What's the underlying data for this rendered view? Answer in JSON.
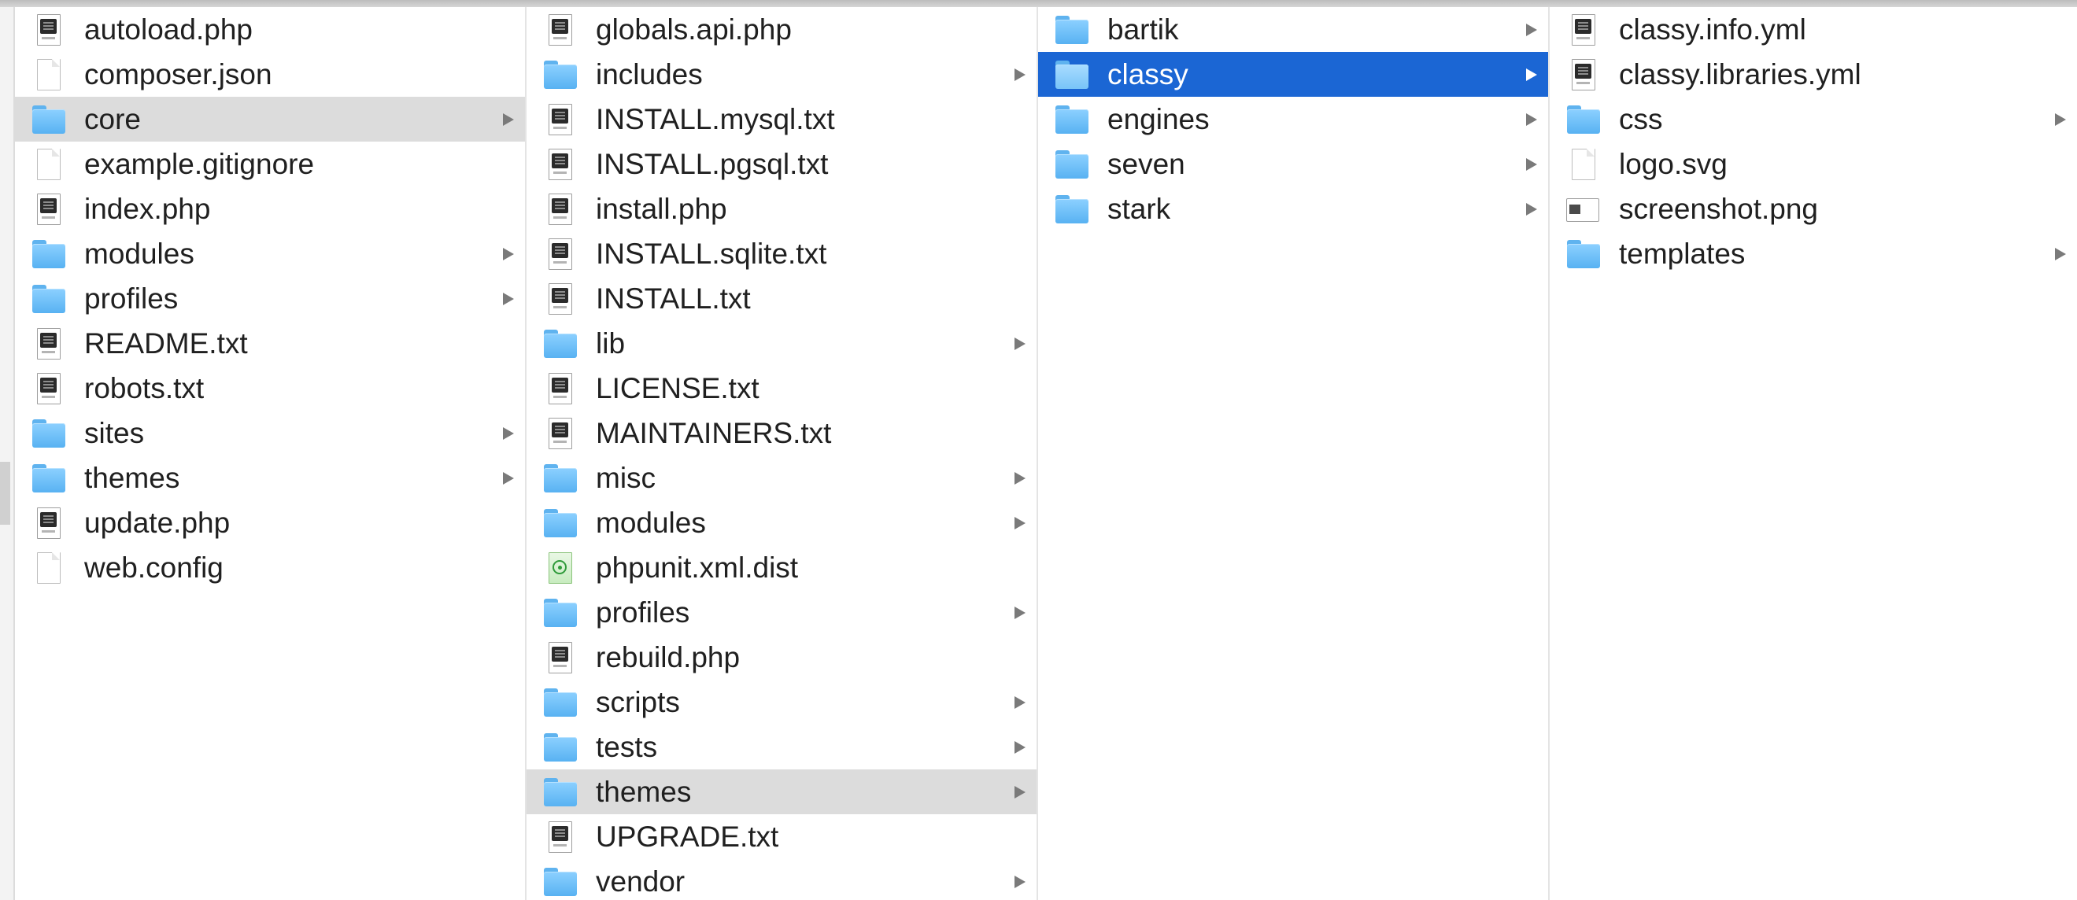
{
  "colors": {
    "selection_blue": "#1b66d4",
    "selection_gray": "#dcdcdc",
    "folder_blue": "#6cc0f8",
    "arrow_gray": "#7a7a7a"
  },
  "columns": [
    {
      "items": [
        {
          "name": "autoload.php",
          "icon": "script-file-icon",
          "folder": false
        },
        {
          "name": "composer.json",
          "icon": "document-icon",
          "folder": false
        },
        {
          "name": "core",
          "icon": "folder-icon",
          "folder": true,
          "state": "path-selected"
        },
        {
          "name": "example.gitignore",
          "icon": "document-icon",
          "folder": false
        },
        {
          "name": "index.php",
          "icon": "script-file-icon",
          "folder": false
        },
        {
          "name": "modules",
          "icon": "folder-icon",
          "folder": true
        },
        {
          "name": "profiles",
          "icon": "folder-icon",
          "folder": true
        },
        {
          "name": "README.txt",
          "icon": "script-file-icon",
          "folder": false
        },
        {
          "name": "robots.txt",
          "icon": "script-file-icon",
          "folder": false
        },
        {
          "name": "sites",
          "icon": "folder-icon",
          "folder": true
        },
        {
          "name": "themes",
          "icon": "folder-icon",
          "folder": true
        },
        {
          "name": "update.php",
          "icon": "script-file-icon",
          "folder": false
        },
        {
          "name": "web.config",
          "icon": "document-icon",
          "folder": false
        }
      ]
    },
    {
      "items": [
        {
          "name": "globals.api.php",
          "icon": "script-file-icon",
          "folder": false
        },
        {
          "name": "includes",
          "icon": "folder-icon",
          "folder": true
        },
        {
          "name": "INSTALL.mysql.txt",
          "icon": "script-file-icon",
          "folder": false
        },
        {
          "name": "INSTALL.pgsql.txt",
          "icon": "script-file-icon",
          "folder": false
        },
        {
          "name": "install.php",
          "icon": "script-file-icon",
          "folder": false
        },
        {
          "name": "INSTALL.sqlite.txt",
          "icon": "script-file-icon",
          "folder": false
        },
        {
          "name": "INSTALL.txt",
          "icon": "script-file-icon",
          "folder": false
        },
        {
          "name": "lib",
          "icon": "folder-icon",
          "folder": true
        },
        {
          "name": "LICENSE.txt",
          "icon": "script-file-icon",
          "folder": false
        },
        {
          "name": "MAINTAINERS.txt",
          "icon": "script-file-icon",
          "folder": false
        },
        {
          "name": "misc",
          "icon": "folder-icon",
          "folder": true
        },
        {
          "name": "modules",
          "icon": "folder-icon",
          "folder": true
        },
        {
          "name": "phpunit.xml.dist",
          "icon": "xml-file-icon",
          "folder": false
        },
        {
          "name": "profiles",
          "icon": "folder-icon",
          "folder": true
        },
        {
          "name": "rebuild.php",
          "icon": "script-file-icon",
          "folder": false
        },
        {
          "name": "scripts",
          "icon": "folder-icon",
          "folder": true
        },
        {
          "name": "tests",
          "icon": "folder-icon",
          "folder": true
        },
        {
          "name": "themes",
          "icon": "folder-icon",
          "folder": true,
          "state": "path-selected"
        },
        {
          "name": "UPGRADE.txt",
          "icon": "script-file-icon",
          "folder": false
        },
        {
          "name": "vendor",
          "icon": "folder-icon",
          "folder": true
        }
      ]
    },
    {
      "items": [
        {
          "name": "bartik",
          "icon": "folder-icon",
          "folder": true
        },
        {
          "name": "classy",
          "icon": "folder-icon",
          "folder": true,
          "state": "selected"
        },
        {
          "name": "engines",
          "icon": "folder-icon",
          "folder": true
        },
        {
          "name": "seven",
          "icon": "folder-icon",
          "folder": true
        },
        {
          "name": "stark",
          "icon": "folder-icon",
          "folder": true
        }
      ]
    },
    {
      "items": [
        {
          "name": "classy.info.yml",
          "icon": "script-file-icon",
          "folder": false
        },
        {
          "name": "classy.libraries.yml",
          "icon": "script-file-icon",
          "folder": false
        },
        {
          "name": "css",
          "icon": "folder-icon",
          "folder": true
        },
        {
          "name": "logo.svg",
          "icon": "document-icon",
          "folder": false
        },
        {
          "name": "screenshot.png",
          "icon": "image-file-icon",
          "folder": false
        },
        {
          "name": "templates",
          "icon": "folder-icon",
          "folder": true
        }
      ]
    }
  ]
}
